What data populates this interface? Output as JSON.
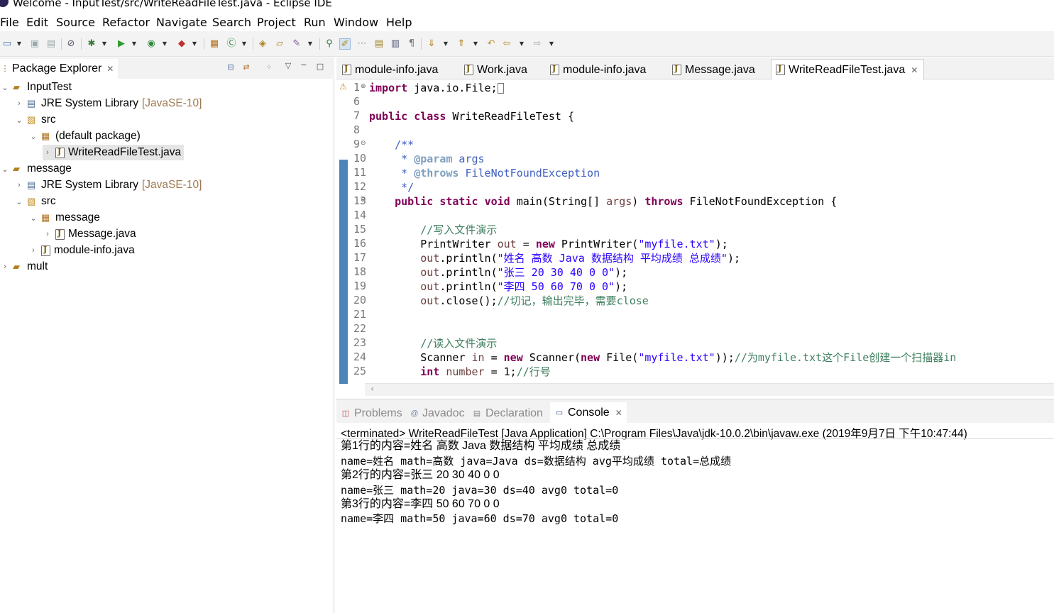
{
  "window": {
    "title": "Welcome - InputTest/src/WriteReadFileTest.java - Eclipse IDE"
  },
  "menu": [
    "File",
    "Edit",
    "Source",
    "Refactor",
    "Navigate",
    "Search",
    "Project",
    "Run",
    "Window",
    "Help"
  ],
  "package_explorer": {
    "title": "Package Explorer",
    "tree": [
      {
        "label": "InputTest",
        "decor": ""
      },
      {
        "label": "JRE System Library",
        "decor": "[JavaSE-10]"
      },
      {
        "label": "src",
        "decor": ""
      },
      {
        "label": "(default package)",
        "decor": ""
      },
      {
        "label": "WriteReadFileTest.java",
        "decor": ""
      },
      {
        "label": "message",
        "decor": ""
      },
      {
        "label": "JRE System Library",
        "decor": "[JavaSE-10]"
      },
      {
        "label": "src",
        "decor": ""
      },
      {
        "label": "message",
        "decor": ""
      },
      {
        "label": "Message.java",
        "decor": ""
      },
      {
        "label": "module-info.java",
        "decor": ""
      },
      {
        "label": "mult",
        "decor": ""
      }
    ]
  },
  "editor": {
    "tabs": [
      "module-info.java",
      "Work.java",
      "module-info.java",
      "Message.java",
      "WriteReadFileTest.java"
    ],
    "active_tab": "WriteReadFileTest.java",
    "line_numbers": [
      "1",
      "6",
      "7",
      "8",
      "9",
      "10",
      "11",
      "12",
      "13",
      "14",
      "15",
      "16",
      "17",
      "18",
      "19",
      "20",
      "21",
      "22",
      "23",
      "24",
      "25"
    ],
    "code": {
      "l1_kw": "import",
      "l1_rest": " java.io.File;",
      "l7_kw1": "public",
      "l7_kw2": "class",
      "l7_rest": " WriteReadFileTest {",
      "l9": "    /**",
      "l10_pre": "     * ",
      "l10_tag": "@param",
      "l10_rest": " args",
      "l11_pre": "     * ",
      "l11_tag": "@throws",
      "l11_rest": " FileNotFoundException",
      "l12": "     */",
      "l13_kw1": "public",
      "l13_kw2": "static",
      "l13_kw3": "void",
      "l13_a": " main(String[] ",
      "l13_var": "args",
      "l13_b": ") ",
      "l13_kw4": "throws",
      "l13_c": " FileNotFoundException {",
      "l15": "//写入文件演示",
      "l16_a": "PrintWriter ",
      "l16_var": "out",
      "l16_b": " = ",
      "l16_kw": "new",
      "l16_c": " PrintWriter(",
      "l16_str": "\"myfile.txt\"",
      "l16_d": ");",
      "l17_var": "out",
      "l17_a": ".println(",
      "l17_str": "\"姓名 高数 Java 数据结构 平均成绩 总成绩\"",
      "l17_b": ");",
      "l18_var": "out",
      "l18_a": ".println(",
      "l18_str": "\"张三 20 30 40 0 0\"",
      "l18_b": ");",
      "l19_var": "out",
      "l19_a": ".println(",
      "l19_str": "\"李四 50 60 70 0 0\"",
      "l19_b": ");",
      "l20_var": "out",
      "l20_a": ".close();",
      "l20_com": "//切记，输出完毕，需要close",
      "l23": "//读入文件演示",
      "l24_a": "Scanner ",
      "l24_var": "in",
      "l24_b": " = ",
      "l24_kw1": "new",
      "l24_c": " Scanner(",
      "l24_kw2": "new",
      "l24_d": " File(",
      "l24_str": "\"myfile.txt\"",
      "l24_e": "));",
      "l24_com": "//为myfile.txt这个File创建一个扫描器in",
      "l25_kw": "int",
      "l25_var": " number",
      "l25_a": " = 1;",
      "l25_com": "//行号"
    }
  },
  "bottom_panel": {
    "tabs": [
      "Problems",
      "Javadoc",
      "Declaration",
      "Console"
    ],
    "active_tab": "Console",
    "terminated": "<terminated> WriteReadFileTest [Java Application] C:\\Program Files\\Java\\jdk-10.0.2\\bin\\javaw.exe (2019年9月7日 下午10:47:44)",
    "output": [
      "第1行的内容=姓名 高数 Java 数据结构 平均成绩 总成绩",
      "name=姓名 math=高数 java=Java ds=数据结构 avg平均成绩 total=总成绩",
      "第2行的内容=张三 20 30 40 0 0",
      "name=张三 math=20 java=30 ds=40 avg0 total=0",
      "第3行的内容=李四 50 60 70 0 0",
      "name=李四 math=50 java=60 ds=70 avg0 total=0"
    ]
  },
  "icons": {
    "close": "close-icon",
    "minimize": "minimize-icon",
    "maximize": "maximize-icon",
    "java_file": "java-file-icon",
    "project": "project-icon",
    "package": "package-icon",
    "library": "library-icon"
  },
  "colors": {
    "keyword": "#7f0055",
    "string": "#2a00ff",
    "comment": "#3f7f5f",
    "javadoc": "#3f5fbf",
    "local_var": "#6a3e3e",
    "gutter_marker": "#4e84b8",
    "decoration": "#a07a50"
  }
}
